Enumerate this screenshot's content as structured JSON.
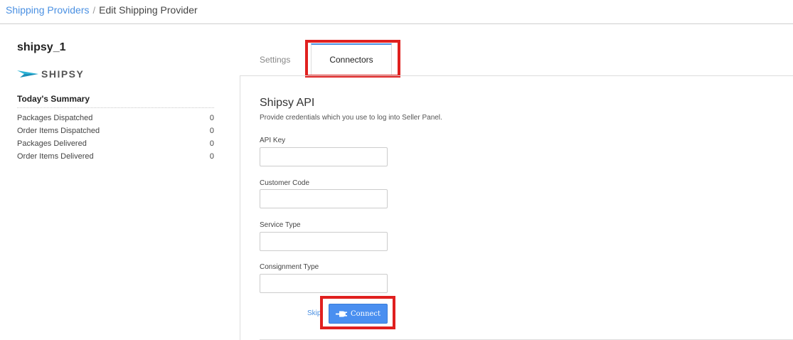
{
  "breadcrumb": {
    "parent": "Shipping Providers",
    "separator": "/",
    "current": "Edit Shipping Provider"
  },
  "provider": {
    "name": "shipsy_1",
    "logo_text": "SHIPSY"
  },
  "summary": {
    "title": "Today's Summary",
    "rows": [
      {
        "label": "Packages Dispatched",
        "value": "0"
      },
      {
        "label": "Order Items Dispatched",
        "value": "0"
      },
      {
        "label": "Packages Delivered",
        "value": "0"
      },
      {
        "label": "Order Items Delivered",
        "value": "0"
      }
    ]
  },
  "tabs": {
    "settings": "Settings",
    "connectors": "Connectors",
    "active": "connectors"
  },
  "connector": {
    "title": "Shipsy API",
    "description": "Provide credentials which you use to log into Seller Panel.",
    "fields": [
      {
        "label": "API Key",
        "value": ""
      },
      {
        "label": "Customer Code",
        "value": ""
      },
      {
        "label": "Service Type",
        "value": ""
      },
      {
        "label": "Consignment Type",
        "value": ""
      }
    ],
    "skip_label": "Skip",
    "connect_label": "Connect",
    "connect_icon": "plug-icon"
  },
  "colors": {
    "link": "#4a90e2",
    "primary_button": "#4a8ff0",
    "highlight": "#e0201f",
    "logo_accent": "#2bb3d6"
  }
}
